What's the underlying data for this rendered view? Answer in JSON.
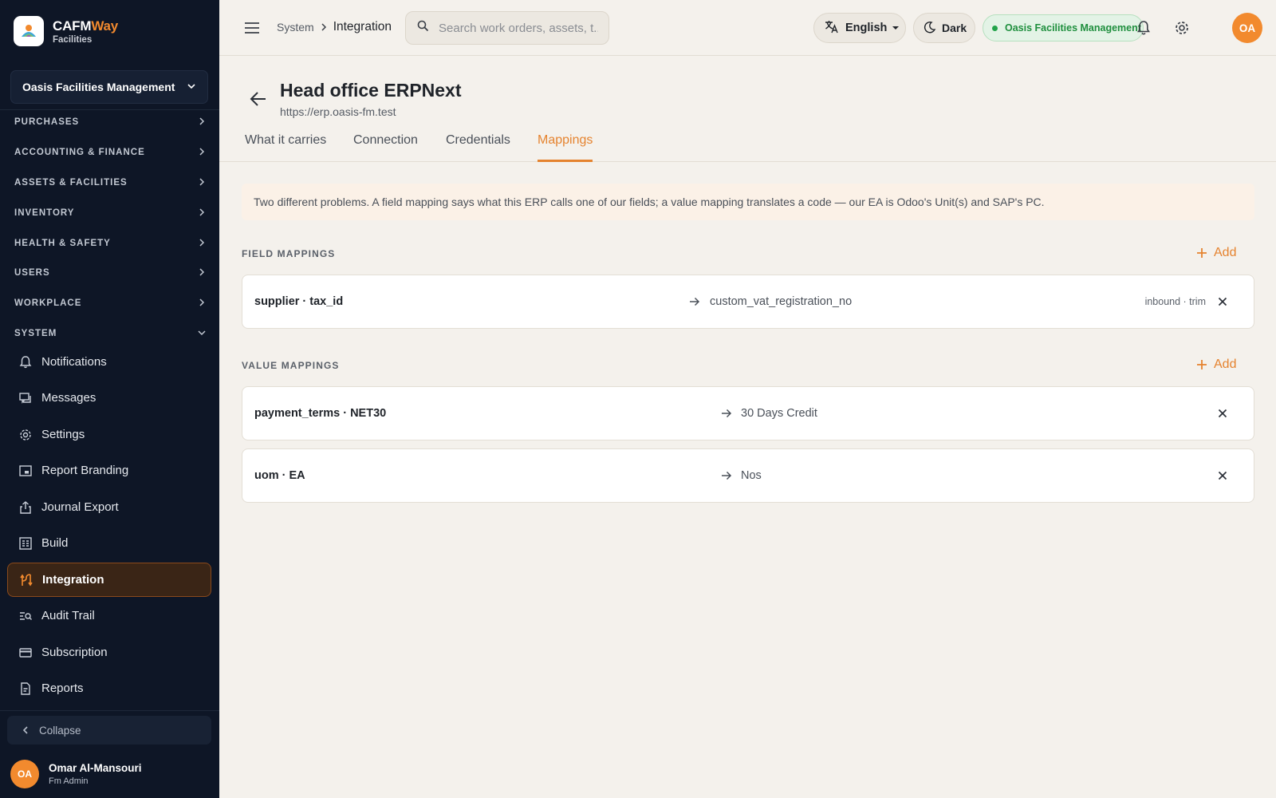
{
  "brand": {
    "name_main": "CAFM",
    "name_accent": "Way",
    "subtitle": "Facilities"
  },
  "sidebar": {
    "org_selector": "Oasis Facilities Management",
    "sections": [
      {
        "label": "PURCHASES",
        "expanded": false
      },
      {
        "label": "ACCOUNTING & FINANCE",
        "expanded": false
      },
      {
        "label": "ASSETS & FACILITIES",
        "expanded": false
      },
      {
        "label": "INVENTORY",
        "expanded": false
      },
      {
        "label": "HEALTH & SAFETY",
        "expanded": false
      },
      {
        "label": "USERS",
        "expanded": false
      },
      {
        "label": "WORKPLACE",
        "expanded": false
      },
      {
        "label": "SYSTEM",
        "expanded": true
      }
    ],
    "items": [
      {
        "label": "Notifications",
        "icon": "bell-icon"
      },
      {
        "label": "Messages",
        "icon": "chat-icon"
      },
      {
        "label": "Settings",
        "icon": "gear-icon"
      },
      {
        "label": "Report Branding",
        "icon": "branding-icon"
      },
      {
        "label": "Journal Export",
        "icon": "export-icon"
      },
      {
        "label": "Build",
        "icon": "build-icon"
      },
      {
        "label": "Integration",
        "icon": "integration-icon",
        "active": true
      },
      {
        "label": "Audit Trail",
        "icon": "audit-icon"
      },
      {
        "label": "Subscription",
        "icon": "card-icon"
      },
      {
        "label": "Reports",
        "icon": "report-icon"
      }
    ],
    "collapse_label": "Collapse",
    "user": {
      "initials": "OA",
      "name": "Omar Al-Mansouri",
      "role": "Fm Admin"
    }
  },
  "topbar": {
    "breadcrumb": [
      "System",
      "Integration"
    ],
    "search_placeholder": "Search work orders, assets, t...",
    "language": "English",
    "theme_label": "Dark",
    "org_badge": "Oasis Facilities Management",
    "avatar_initials": "OA"
  },
  "page": {
    "title": "Head office ERPNext",
    "url": "https://erp.oasis-fm.test",
    "tabs": [
      "What it carries",
      "Connection",
      "Credentials",
      "Mappings"
    ],
    "active_tab": "Mappings",
    "info": "Two different problems. A field mapping says what this ERP calls one of our fields; a value mapping translates a code — our EA is Odoo's Unit(s) and SAP's PC."
  },
  "field_mappings": {
    "title": "FIELD MAPPINGS",
    "add_label": "Add",
    "rows": [
      {
        "key": "supplier · tax_id",
        "value": "custom_vat_registration_no",
        "meta": "inbound · trim"
      }
    ]
  },
  "value_mappings": {
    "title": "VALUE MAPPINGS",
    "add_label": "Add",
    "rows": [
      {
        "key": "payment_terms · NET30",
        "value": "30 Days Credit"
      },
      {
        "key": "uom · EA",
        "value": "Nos"
      }
    ]
  },
  "colors": {
    "accent": "#e5832f",
    "sidebar_bg": "#0e1626",
    "page_bg": "#f4f1ec",
    "success": "#1f8f3e"
  }
}
